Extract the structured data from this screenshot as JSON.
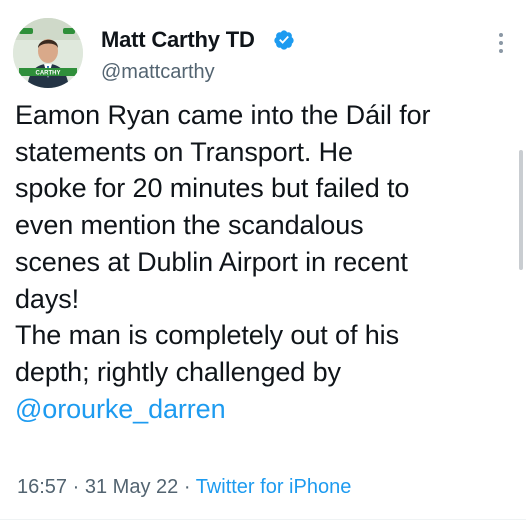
{
  "author": {
    "display_name": "Matt Carthy TD",
    "handle": "@mattcarthy",
    "avatar_banner_text": "CARTHY"
  },
  "tweet": {
    "lines": [
      "Eamon Ryan came into the Dáil for",
      "statements on Transport. He",
      "spoke for 20 minutes but failed to",
      "even mention the scandalous",
      "scenes at Dublin Airport in recent",
      "days!",
      "The man is completely out of his",
      "depth; rightly challenged by"
    ],
    "mention": "@orourke_darren"
  },
  "meta": {
    "time": "16:57",
    "separator": "·",
    "date": "31 May 22",
    "source": "Twitter for iPhone"
  },
  "colors": {
    "link": "#1d9bf0",
    "secondary": "#536471",
    "verified": "#1d9bf0"
  },
  "icons": {
    "verified": "verified-badge-icon",
    "more": "more-options-icon"
  }
}
